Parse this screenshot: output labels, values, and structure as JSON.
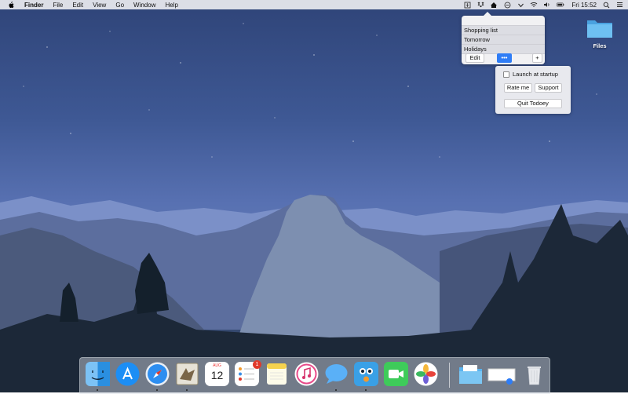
{
  "menubar": {
    "apple_icon": "apple-icon",
    "app_name": "Finder",
    "menus": [
      "File",
      "Edit",
      "View",
      "Go",
      "Window",
      "Help"
    ],
    "status_icons": [
      "accessibility-icon",
      "dropbox-icon",
      "todoey-icon",
      "circle-icon",
      "check-icon",
      "wifi-icon",
      "volume-icon",
      "battery-icon"
    ],
    "battery_label": "⊞",
    "clock": "Fri 15:52",
    "search_icon": "search-icon",
    "control_icon": "list-icon"
  },
  "todoey": {
    "lists": [
      "Shopping list",
      "Tomorrow",
      "Holidays"
    ],
    "edit_label": "Edit",
    "more_label": "•••",
    "add_label": "+",
    "settings": {
      "launch_label": "Launch at startup",
      "rate_label": "Rate me",
      "support_label": "Support",
      "quit_label": "Quit Todoey"
    }
  },
  "desktop": {
    "files_label": "Files"
  },
  "dock": {
    "calendar_month": "AUG",
    "calendar_day": "12",
    "reminders_badge": "1"
  },
  "colors": {
    "accent": "#2f7df6",
    "menubar": "#ececf0",
    "folder": "#5ab3ee"
  }
}
